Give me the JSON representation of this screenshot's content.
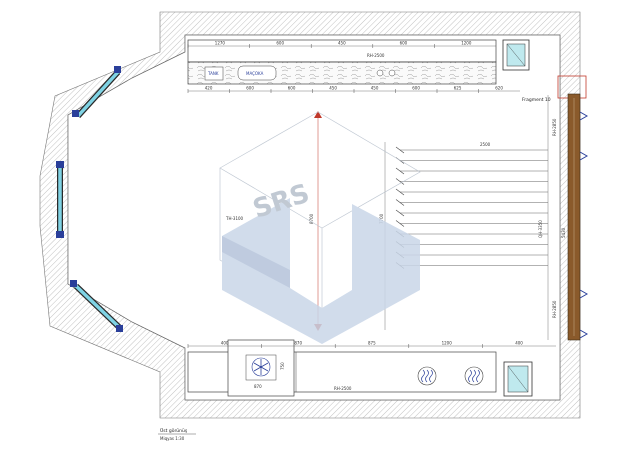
{
  "plan": {
    "top_dims": [
      "1270",
      "600",
      "450",
      "600",
      "1200"
    ],
    "top_bottom_dims": [
      "420",
      "600",
      "600",
      "450",
      "450",
      "600",
      "625",
      "620"
    ],
    "top_labels": {
      "tank": "TANK",
      "sink": "MAÇOKA",
      "counter": "RH-2500"
    },
    "fragment": "Fragment 10",
    "left_labels": {
      "tah": "TH-3100",
      "mid": "5230"
    },
    "right_dims": {
      "top": "RH-2850",
      "mid": "QH-3350",
      "mid2": "5430",
      "bottom": "RH-2850"
    },
    "shelf_dim": "2500",
    "bottom_top_dims": [
      "400",
      "870",
      "875",
      "1200",
      "400"
    ],
    "bottom_labels": {
      "counter": "RH-2500",
      "hob_w": "870",
      "hob_d": "750"
    },
    "vertical_dims": {
      "a": "8700",
      "b": "7700"
    },
    "caption": {
      "title": "Üst görünüş",
      "scale": "Miqyas 1:30"
    },
    "watermark": "SRS"
  },
  "colors": {
    "window": "#7fd3e4",
    "glass": "#bfe9ee",
    "watermark": "#c9d6e8",
    "accent_red": "#c0392b",
    "door": "#8a5a2b",
    "blue_marker": "#2a3f9a"
  }
}
